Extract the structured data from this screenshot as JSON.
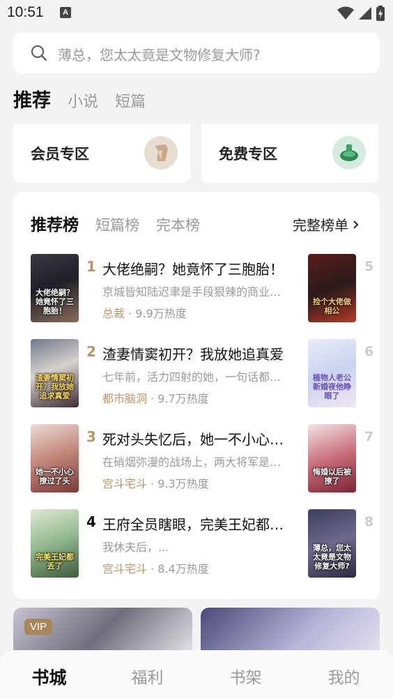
{
  "status": {
    "time": "10:51",
    "notify_glyph": "A"
  },
  "search": {
    "placeholder": "薄总，您太太竟是文物修复大师?"
  },
  "top_tabs": [
    {
      "label": "推荐",
      "active": true
    },
    {
      "label": "小说",
      "active": false
    },
    {
      "label": "短篇",
      "active": false
    }
  ],
  "zones": {
    "vip": {
      "label": "会员专区",
      "color": "#e8ddd2"
    },
    "free": {
      "label": "免费专区",
      "color": "#d6ebe0"
    }
  },
  "rank": {
    "tabs": [
      {
        "label": "推荐榜",
        "active": true
      },
      {
        "label": "短篇榜",
        "active": false
      },
      {
        "label": "完本榜",
        "active": false
      }
    ],
    "full_label": "完整榜单",
    "books": [
      {
        "rank": "1",
        "title": "大佬绝嗣？她竟怀了三胞胎！",
        "desc": "京城皆知陆迟聿是手段狠辣的商业大佬",
        "category": "总裁",
        "heat": "9.9万热度",
        "cover_text": "大佬绝嗣？她竟怀了三胞胎！"
      },
      {
        "rank": "2",
        "title": "渣妻情窦初开？我放她追真爱",
        "desc": "七年前，活力四射的她，一句话都没说",
        "category": "都市脑洞",
        "heat": "9.7万热度",
        "cover_text": "渣妻情窦初开？我放她追求真爱"
      },
      {
        "rank": "3",
        "title": "死对头失忆后，她一不小心撩过了头",
        "desc": "在硝烟弥漫的战场上，两大将军是死对头",
        "category": "宫斗宅斗",
        "heat": "9.3万热度",
        "cover_text": "她一不小心撩过了头"
      },
      {
        "rank": "4",
        "title": "王府全员瞎眼，完美王妃都丢了",
        "desc": "我休夫后，...",
        "category": "宫斗宅斗",
        "heat": "8.4万热度",
        "cover_text": "完美王妃都丢了"
      }
    ],
    "side_books": [
      {
        "rank": "5",
        "cover_text": "捡个大佬做相公"
      },
      {
        "rank": "6",
        "cover_text": "植物人老公新婚夜他睁眼了"
      },
      {
        "rank": "7",
        "cover_text": "悔婚以后被撩了"
      },
      {
        "rank": "8",
        "cover_text": "薄总，您太太竟是文物修复大师?"
      }
    ]
  },
  "promo": {
    "vip_label": "VIP"
  },
  "bottom_nav": [
    {
      "label": "书城",
      "active": true
    },
    {
      "label": "福利",
      "active": false
    },
    {
      "label": "书架",
      "active": false
    },
    {
      "label": "我的",
      "active": false
    }
  ]
}
